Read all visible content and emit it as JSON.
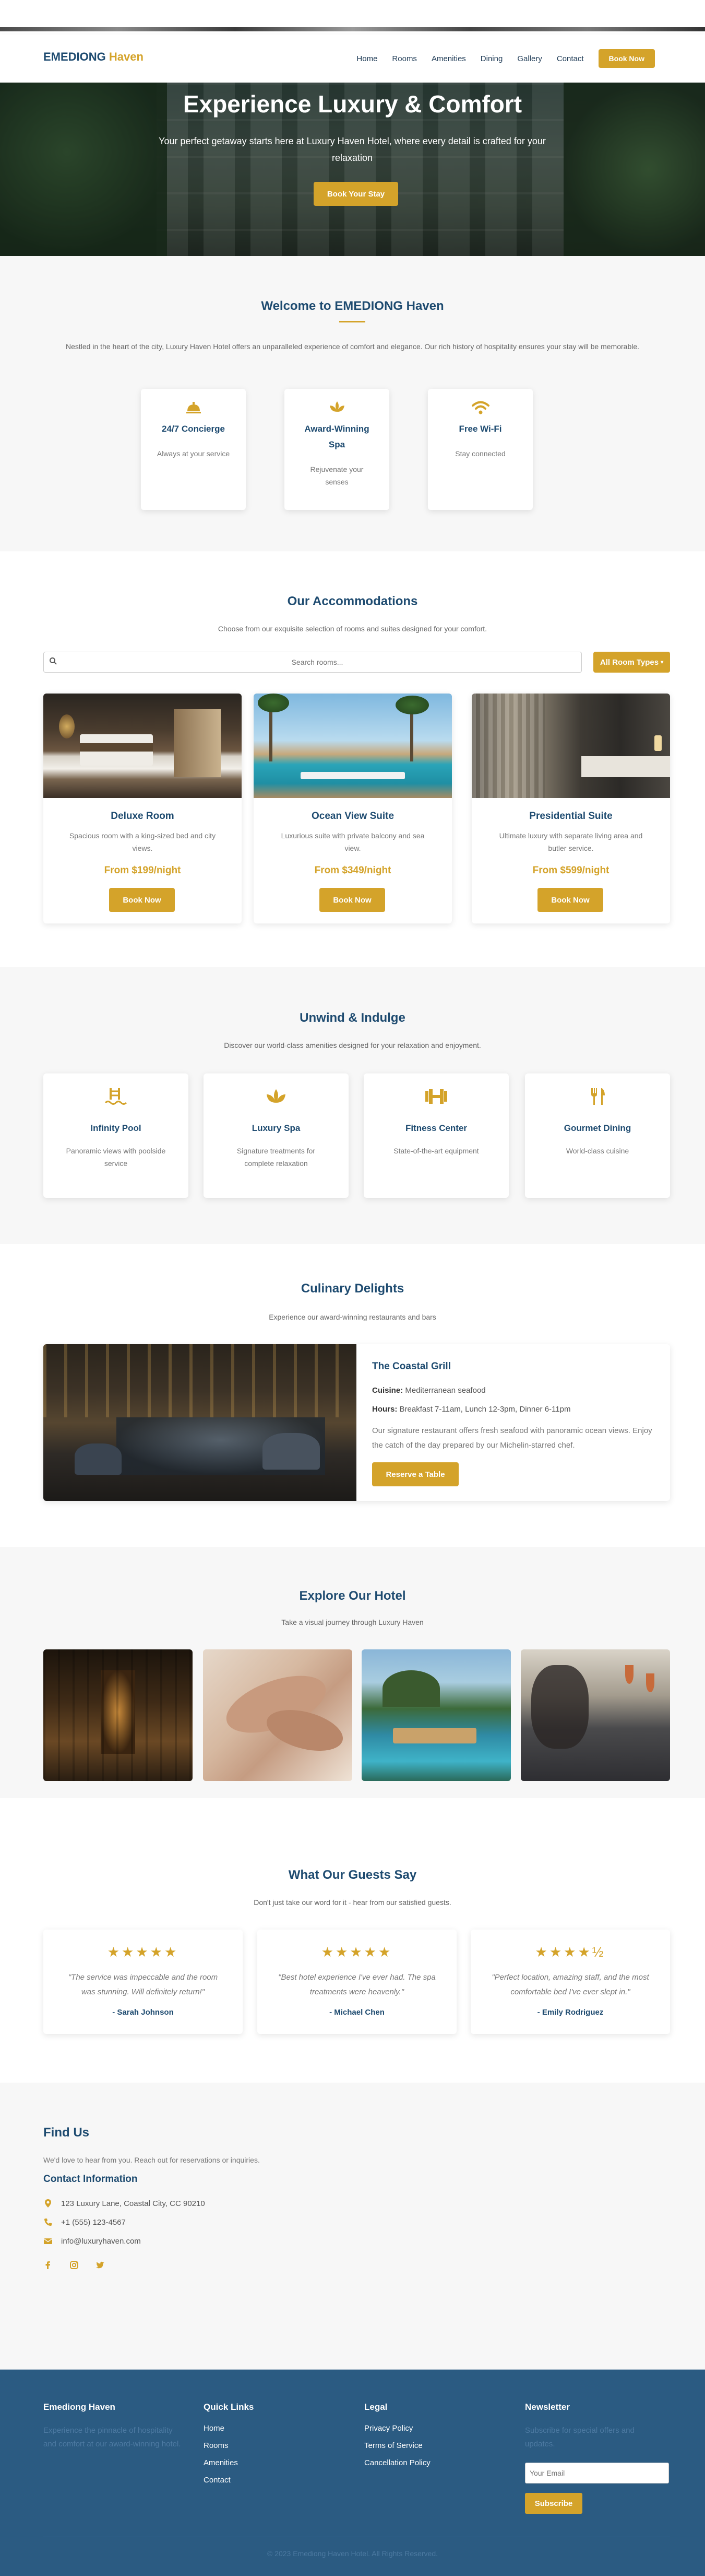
{
  "nav": {
    "logo_main": "EMEDIONG",
    "logo_accent": "Haven",
    "links": [
      "Home",
      "Rooms",
      "Amenities",
      "Dining",
      "Gallery",
      "Contact"
    ],
    "book_button": "Book Now"
  },
  "hero": {
    "title": "Experience Luxury & Comfort",
    "subtitle": "Your perfect getaway starts here at Luxury Haven Hotel, where every detail is crafted for your relaxation",
    "button": "Book Your Stay"
  },
  "welcome": {
    "title": "Welcome to EMEDIONG Haven",
    "text": "Nestled in the heart of the city, Luxury Haven Hotel offers an unparalleled experience of comfort and elegance. Our rich history of hospitality ensures your stay will be memorable.",
    "features": [
      {
        "icon": "concierge-bell-icon",
        "title": "24/7 Concierge",
        "desc": "Always at your service"
      },
      {
        "icon": "spa-icon",
        "title": "Award-Winning Spa",
        "desc": "Rejuvenate your senses"
      },
      {
        "icon": "wifi-icon",
        "title": "Free Wi-Fi",
        "desc": "Stay connected"
      }
    ]
  },
  "rooms": {
    "title": "Our Accommodations",
    "subtitle": "Choose from our exquisite selection of rooms and suites designed for your comfort.",
    "search_placeholder": "Search rooms...",
    "filter_selected": "All Room Types",
    "items": [
      {
        "title": "Deluxe Room",
        "desc": "Spacious room with a king-sized bed and city views.",
        "price": "From $199/night",
        "button": "Book Now"
      },
      {
        "title": "Ocean View Suite",
        "desc": "Luxurious suite with private balcony and sea view.",
        "price": "From $349/night",
        "button": "Book Now"
      },
      {
        "title": "Presidential Suite",
        "desc": "Ultimate luxury with separate living area and butler service.",
        "price": "From $599/night",
        "button": "Book Now"
      }
    ]
  },
  "amenities": {
    "title": "Unwind & Indulge",
    "subtitle": "Discover our world-class amenities designed for your relaxation and enjoyment.",
    "items": [
      {
        "icon": "pool-ladder-icon",
        "title": "Infinity Pool",
        "desc": "Panoramic views with poolside service"
      },
      {
        "icon": "spa-lotus-icon",
        "title": "Luxury Spa",
        "desc": "Signature treatments for complete relaxation"
      },
      {
        "icon": "dumbbell-icon",
        "title": "Fitness Center",
        "desc": "State-of-the-art equipment"
      },
      {
        "icon": "utensils-icon",
        "title": "Gourmet Dining",
        "desc": "World-class cuisine"
      }
    ]
  },
  "dining": {
    "title": "Culinary Delights",
    "subtitle": "Experience our award-winning restaurants and bars",
    "name": "The Coastal Grill",
    "cuisine_label": "Cuisine:",
    "cuisine": "Mediterranean seafood",
    "hours_label": "Hours:",
    "hours": "Breakfast 7-11am, Lunch 12-3pm, Dinner 6-11pm",
    "desc": "Our signature restaurant offers fresh seafood with panoramic ocean views. Enjoy the catch of the day prepared by our Michelin-starred chef.",
    "button": "Reserve a Table"
  },
  "gallery": {
    "title": "Explore Our Hotel",
    "subtitle": "Take a visual journey through Luxury Haven"
  },
  "testimonials": {
    "title": "What Our Guests Say",
    "subtitle": "Don't just take our word for it - hear from our satisfied guests.",
    "items": [
      {
        "stars": "★★★★★",
        "rating": 5,
        "quote": "\"The service was impeccable and the room was stunning. Will definitely return!\"",
        "name": "- Sarah Johnson"
      },
      {
        "stars": "★★★★★",
        "rating": 5,
        "quote": "\"Best hotel experience I've ever had. The spa treatments were heavenly.\"",
        "name": "- Michael Chen"
      },
      {
        "stars": "★★★★½",
        "rating": 4.5,
        "quote": "\"Perfect location, amazing staff, and the most comfortable bed I've ever slept in.\"",
        "name": "- Emily Rodriguez"
      }
    ]
  },
  "contact": {
    "title": "Find Us",
    "text": "We'd love to hear from you. Reach out for reservations or inquiries.",
    "info_title": "Contact Information",
    "address": "123 Luxury Lane, Coastal City, CC 90210",
    "phone": "+1 (555) 123-4567",
    "email": "info@luxuryhaven.com",
    "social": [
      "facebook-icon",
      "instagram-icon",
      "twitter-icon"
    ]
  },
  "footer": {
    "brand": "Emediong Haven",
    "brand_text": "Experience the pinnacle of hospitality and comfort at our award-winning hotel.",
    "quick_title": "Quick Links",
    "quick_links": [
      "Home",
      "Rooms",
      "Amenities",
      "Contact"
    ],
    "legal_title": "Legal",
    "legal_links": [
      "Privacy Policy",
      "Terms of Service",
      "Cancellation Policy"
    ],
    "newsletter_title": "Newsletter",
    "newsletter_text": "Subscribe for special offers and updates.",
    "email_placeholder": "Your Email",
    "subscribe": "Subscribe",
    "copyright": "© 2023 Emediong Haven Hotel. All Rights Reserved."
  },
  "colors": {
    "brand": "#1e4b70",
    "accent": "#d4a32a",
    "footer_bg": "#2b5b82"
  }
}
